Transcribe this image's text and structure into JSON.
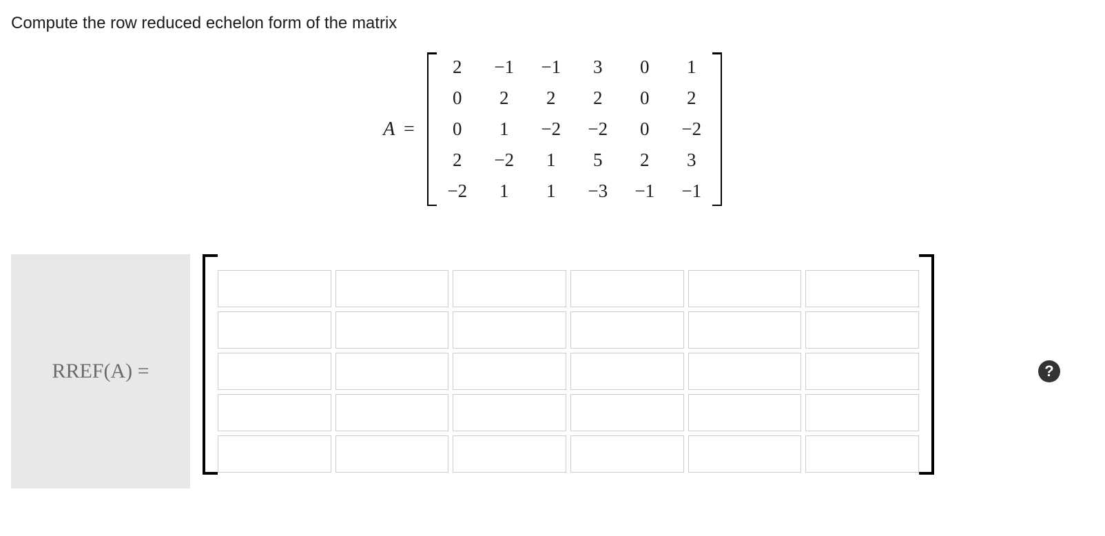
{
  "prompt": "Compute the row reduced echelon form of the matrix",
  "matrixLabel": "A",
  "equals": "=",
  "matrix": [
    [
      "2",
      "−1",
      "−1",
      "3",
      "0",
      "1"
    ],
    [
      "0",
      "2",
      "2",
      "2",
      "0",
      "2"
    ],
    [
      "0",
      "1",
      "−2",
      "−2",
      "0",
      "−2"
    ],
    [
      "2",
      "−2",
      "1",
      "5",
      "2",
      "3"
    ],
    [
      "−2",
      "1",
      "1",
      "−3",
      "−1",
      "−1"
    ]
  ],
  "answer": {
    "label": "RREF(A) =",
    "rows": 5,
    "cols": 6
  },
  "help": "?"
}
